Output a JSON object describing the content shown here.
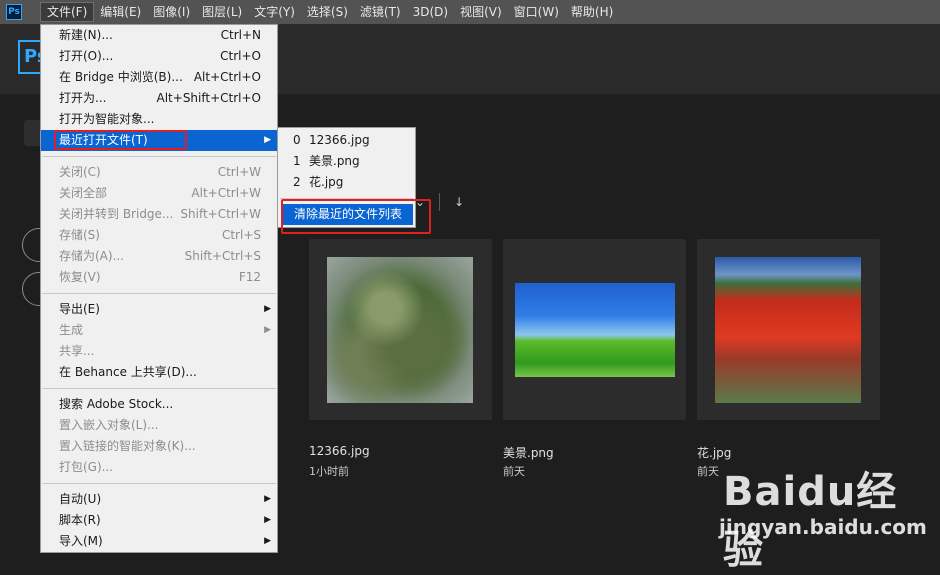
{
  "menubar": {
    "app_icon": "Ps",
    "items": [
      "文件(F)",
      "编辑(E)",
      "图像(I)",
      "图层(L)",
      "文字(Y)",
      "选择(S)",
      "滤镜(T)",
      "3D(D)",
      "视图(V)",
      "窗口(W)",
      "帮助(H)"
    ]
  },
  "home": {
    "logo": "Ps",
    "recent_files": [
      {
        "name": "12366.jpg",
        "time": "1小时前"
      },
      {
        "name": "美景.png",
        "time": "前天"
      },
      {
        "name": "花.jpg",
        "time": "前天"
      }
    ]
  },
  "file_menu": {
    "items": [
      {
        "label": "新建(N)...",
        "shortcut": "Ctrl+N"
      },
      {
        "label": "打开(O)...",
        "shortcut": "Ctrl+O"
      },
      {
        "label": "在 Bridge 中浏览(B)...",
        "shortcut": "Alt+Ctrl+O"
      },
      {
        "label": "打开为...",
        "shortcut": "Alt+Shift+Ctrl+O"
      },
      {
        "label": "打开为智能对象...",
        "shortcut": ""
      },
      {
        "label": "最近打开文件(T)",
        "shortcut": ""
      },
      {
        "label": "关闭(C)",
        "shortcut": "Ctrl+W"
      },
      {
        "label": "关闭全部",
        "shortcut": "Alt+Ctrl+W"
      },
      {
        "label": "关闭并转到 Bridge...",
        "shortcut": "Shift+Ctrl+W"
      },
      {
        "label": "存储(S)",
        "shortcut": "Ctrl+S"
      },
      {
        "label": "存储为(A)...",
        "shortcut": "Shift+Ctrl+S"
      },
      {
        "label": "恢复(V)",
        "shortcut": "F12"
      },
      {
        "label": "导出(E)",
        "shortcut": ""
      },
      {
        "label": "生成",
        "shortcut": ""
      },
      {
        "label": "共享...",
        "shortcut": ""
      },
      {
        "label": "在 Behance 上共享(D)...",
        "shortcut": ""
      },
      {
        "label": "搜索 Adobe Stock...",
        "shortcut": ""
      },
      {
        "label": "置入嵌入对象(L)...",
        "shortcut": ""
      },
      {
        "label": "置入链接的智能对象(K)...",
        "shortcut": ""
      },
      {
        "label": "打包(G)...",
        "shortcut": ""
      },
      {
        "label": "自动(U)",
        "shortcut": ""
      },
      {
        "label": "脚本(R)",
        "shortcut": ""
      },
      {
        "label": "导入(M)",
        "shortcut": ""
      }
    ]
  },
  "recent_submenu": {
    "items": [
      {
        "num": "0",
        "name": "12366.jpg"
      },
      {
        "num": "1",
        "name": "美景.png"
      },
      {
        "num": "2",
        "name": "花.jpg"
      }
    ],
    "clear_label": "清除最近的文件列表"
  },
  "watermark": {
    "logo": "Baidu经验",
    "url": "jingyan.baidu.com"
  },
  "colors": {
    "highlight": "#0a64d2",
    "annotation": "#e02020",
    "ps_blue": "#31a8ff"
  }
}
